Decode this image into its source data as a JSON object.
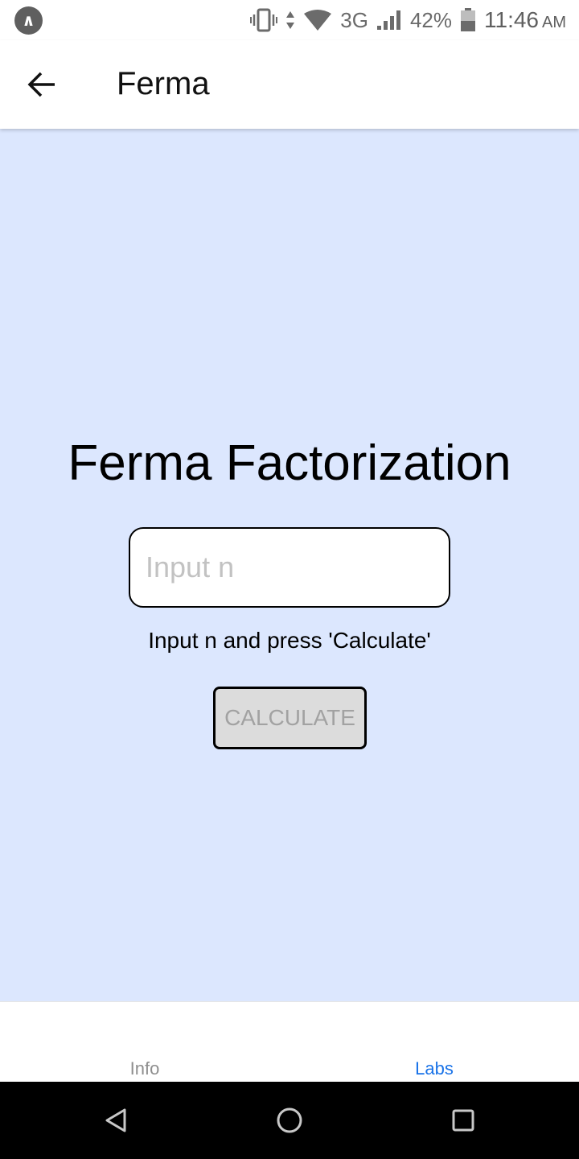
{
  "status_bar": {
    "network": "3G",
    "battery": "42%",
    "time": "11:46",
    "ampm": "AM",
    "icons": [
      "app-notification-icon",
      "vibrate-icon",
      "data-arrows-icon",
      "wifi-icon",
      "signal-icon",
      "battery-icon"
    ]
  },
  "app_bar": {
    "title": "Ferma"
  },
  "main": {
    "title": "Ferma Factorization",
    "input": {
      "placeholder": "Input n",
      "value": ""
    },
    "hint": "Input n and press 'Calculate'",
    "calculate_label": "CALCULATE"
  },
  "tabs": [
    {
      "label": "Info",
      "active": false
    },
    {
      "label": "Labs",
      "active": true
    }
  ],
  "colors": {
    "main_background": "#dce7fe",
    "active_tab": "#1a73e8",
    "inactive_tab": "#8e8e8e",
    "button_background": "#dcdcdc",
    "button_text": "#a2a2a2"
  }
}
